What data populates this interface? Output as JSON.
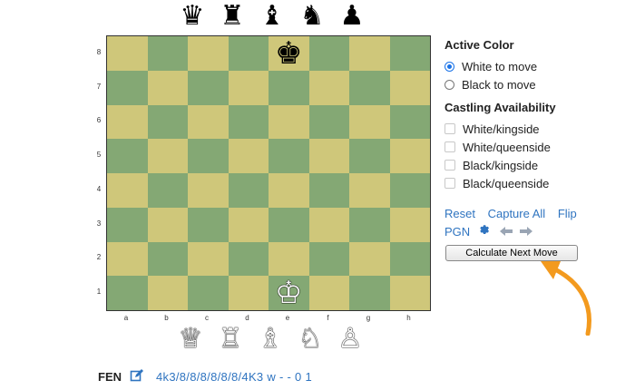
{
  "top_tray": [
    {
      "name": "black-queen",
      "glyph": "♛"
    },
    {
      "name": "black-rook",
      "glyph": "♜"
    },
    {
      "name": "black-bishop",
      "glyph": "♝"
    },
    {
      "name": "black-knight",
      "glyph": "♞"
    },
    {
      "name": "black-pawn",
      "glyph": "♟"
    }
  ],
  "bottom_tray": [
    {
      "name": "white-queen",
      "glyph": "♕"
    },
    {
      "name": "white-rook",
      "glyph": "♖"
    },
    {
      "name": "white-bishop",
      "glyph": "♗"
    },
    {
      "name": "white-knight",
      "glyph": "♘"
    },
    {
      "name": "white-pawn",
      "glyph": "♙"
    }
  ],
  "board": {
    "ranks": [
      "8",
      "7",
      "6",
      "5",
      "4",
      "3",
      "2",
      "1"
    ],
    "files": [
      "a",
      "b",
      "c",
      "d",
      "e",
      "f",
      "g",
      "h"
    ],
    "pieces": [
      {
        "square": "e8",
        "glyph": "♚",
        "color": "black",
        "name": "black-king"
      },
      {
        "square": "e1",
        "glyph": "♔",
        "color": "white",
        "name": "white-king"
      }
    ],
    "light_color": "#cfc77a",
    "dark_color": "#84a874"
  },
  "active_color": {
    "title": "Active Color",
    "options": [
      {
        "label": "White to move",
        "checked": true
      },
      {
        "label": "Black to move",
        "checked": false
      }
    ]
  },
  "castling": {
    "title": "Castling Availability",
    "options": [
      {
        "label": "White/kingside",
        "checked": false
      },
      {
        "label": "White/queenside",
        "checked": false
      },
      {
        "label": "Black/kingside",
        "checked": false
      },
      {
        "label": "Black/queenside",
        "checked": false
      }
    ]
  },
  "links": {
    "reset": "Reset",
    "capture_all": "Capture All",
    "flip": "Flip",
    "pgn": "PGN"
  },
  "calc_button": "Calculate Next Move",
  "fen": {
    "label": "FEN",
    "value": "4k3/8/8/8/8/8/8/4K3 w - - 0 1"
  },
  "accent_color": "#f39a1e"
}
